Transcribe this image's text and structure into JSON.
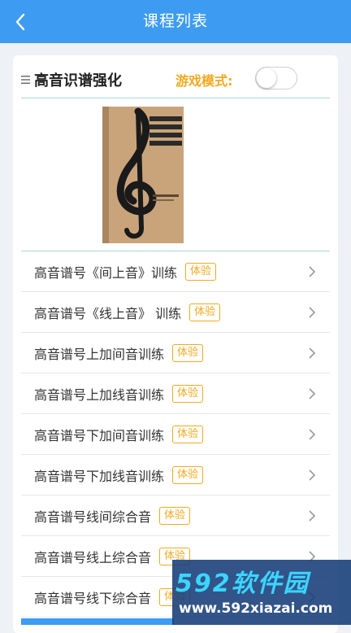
{
  "header": {
    "title": "课程列表",
    "back_icon": "chevron-left-icon"
  },
  "course": {
    "title": "高音识谱强化",
    "game_mode_label": "游戏模式:",
    "game_mode_on": false
  },
  "lessons": [
    {
      "label": "高音谱号《间上音》训练",
      "badge": "体验"
    },
    {
      "label": "高音谱号《线上音》 训练",
      "badge": "体验"
    },
    {
      "label": "高音谱号上加间音训练",
      "badge": "体验"
    },
    {
      "label": "高音谱号上加线音训练",
      "badge": "体验"
    },
    {
      "label": "高音谱号下加间音训练",
      "badge": "体验"
    },
    {
      "label": "高音谱号下加线音训练",
      "badge": "体验"
    },
    {
      "label": "高音谱号线间综合音",
      "badge": "体验"
    },
    {
      "label": "高音谱号线上综合音",
      "badge": "体验"
    },
    {
      "label": "高音谱号线下综合音",
      "badge": "体验"
    }
  ],
  "watermark": {
    "title": "592软件园",
    "url": "www.592xiazai.com"
  },
  "colors": {
    "primary": "#3d9cf2",
    "accent": "#f2a91f"
  }
}
